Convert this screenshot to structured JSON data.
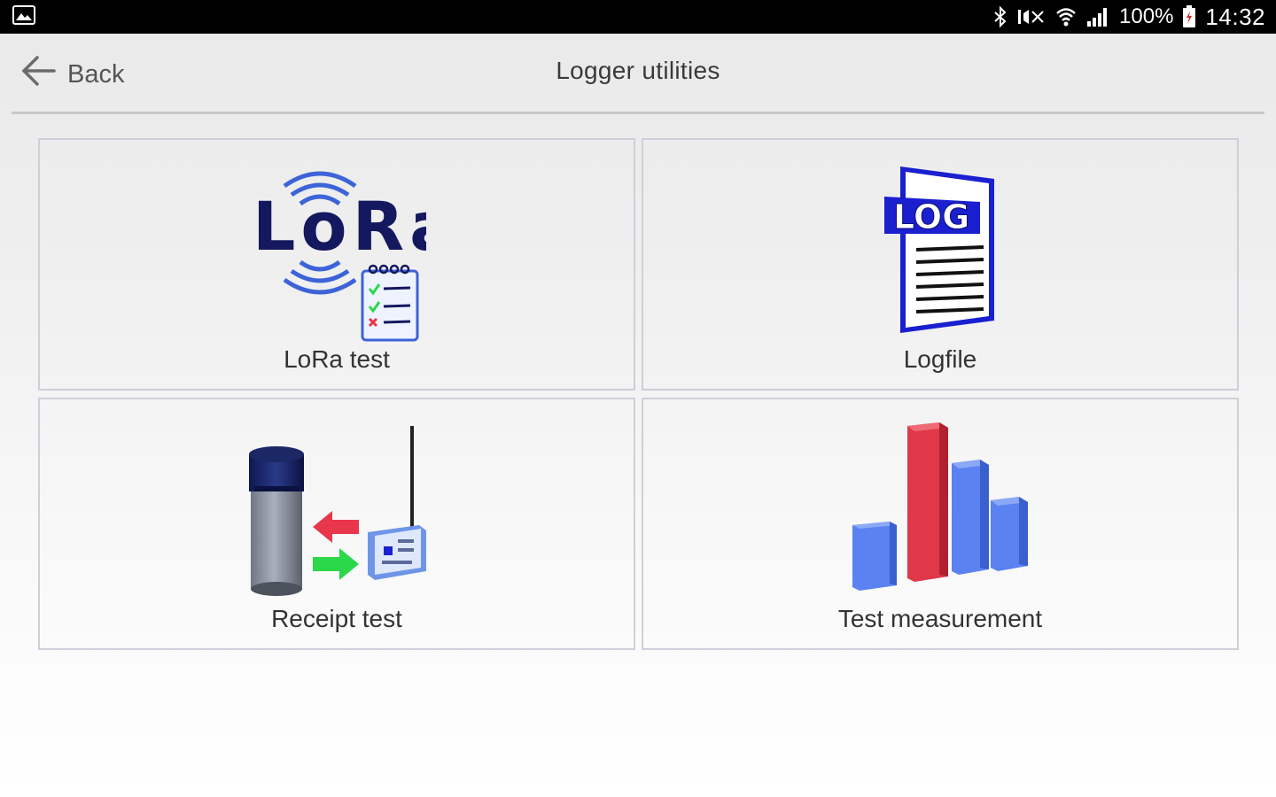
{
  "status_bar": {
    "battery": "100%",
    "time": "14:32",
    "icons": [
      "gallery-icon",
      "bluetooth-icon",
      "mute-icon",
      "wifi-icon",
      "signal-icon",
      "battery-icon"
    ]
  },
  "header": {
    "back_label": "Back",
    "title": "Logger utilities"
  },
  "tiles": [
    {
      "label": "LoRa test",
      "icon": "lora-test-icon",
      "logo_text": "LoRa"
    },
    {
      "label": "Logfile",
      "icon": "logfile-icon",
      "logo_text": "LOG"
    },
    {
      "label": "Receipt test",
      "icon": "receipt-test-icon"
    },
    {
      "label": "Test measurement",
      "icon": "bar-chart-icon"
    }
  ],
  "colors": {
    "status_bar_bg": "#000000",
    "lora_navy": "#14185e",
    "lora_blue": "#3d63d8",
    "log_blue": "#1a1fcf",
    "bar_blue": "#5a82f0",
    "bar_red": "#e03848",
    "arrow_red": "#e8364a",
    "arrow_green": "#2ad84a"
  }
}
